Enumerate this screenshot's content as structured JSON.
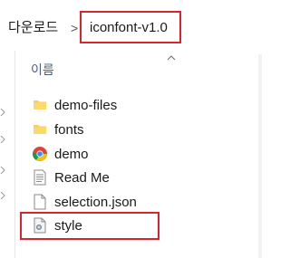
{
  "address": {
    "parent": "다운로드",
    "separator": ">",
    "current": "iconfont-v1.0"
  },
  "list": {
    "column_header": "이름",
    "items": [
      {
        "name": "demo-files",
        "icon": "folder-icon"
      },
      {
        "name": "fonts",
        "icon": "folder-icon"
      },
      {
        "name": "demo",
        "icon": "chrome-icon"
      },
      {
        "name": "Read Me",
        "icon": "text-file-icon"
      },
      {
        "name": "selection.json",
        "icon": "file-icon"
      },
      {
        "name": "style",
        "icon": "stylesheet-icon"
      }
    ]
  },
  "colors": {
    "highlight": "#d9232d",
    "folder": "#f8cf5a",
    "header_text": "#4c607a"
  }
}
